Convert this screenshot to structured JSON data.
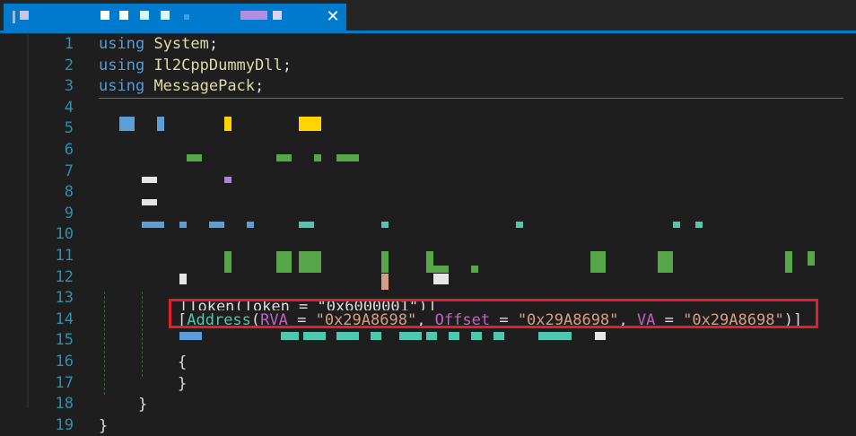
{
  "tab": {
    "title": "",
    "close_glyph": "✕"
  },
  "line_numbers": [
    "1",
    "2",
    "3",
    "4",
    "5",
    "6",
    "7",
    "8",
    "9",
    "10",
    "11",
    "12",
    "13",
    "14",
    "15",
    "16",
    "17",
    "18",
    "19"
  ],
  "code": {
    "line1": {
      "kw": "using",
      "ns": "System",
      "end": ";"
    },
    "line2": {
      "kw": "using",
      "ns": "Il2CppDummyDll",
      "end": ";"
    },
    "line3": {
      "kw": "using",
      "ns": "MessagePack",
      "end": ";"
    },
    "line13_partial": "[Token(Token = \"0x6000001\")]",
    "line14": {
      "open": "[",
      "attr": "Address",
      "p1": "RVA",
      "eq1": " = ",
      "v1": "\"0x29A8698\"",
      "sep1": ", ",
      "p2": "Offset",
      "eq2": " = ",
      "v2": "\"0x29A8698\"",
      "sep2": ", ",
      "p3": "VA",
      "eq3": " = ",
      "v3": "\"0x29A8698\"",
      "close": ")]"
    },
    "line16": "{",
    "line17": "}",
    "line18": "}",
    "line19": "}"
  },
  "colors": {
    "background": "#1e1e1e",
    "tab_active": "#007acc",
    "keyword": "#569cd6",
    "namespace": "#dcdcaa",
    "type": "#4ec9b0",
    "string": "#d69d85",
    "parameter": "#bd63c5",
    "line_number": "#2b91af",
    "highlight_box": "#e0202a"
  }
}
